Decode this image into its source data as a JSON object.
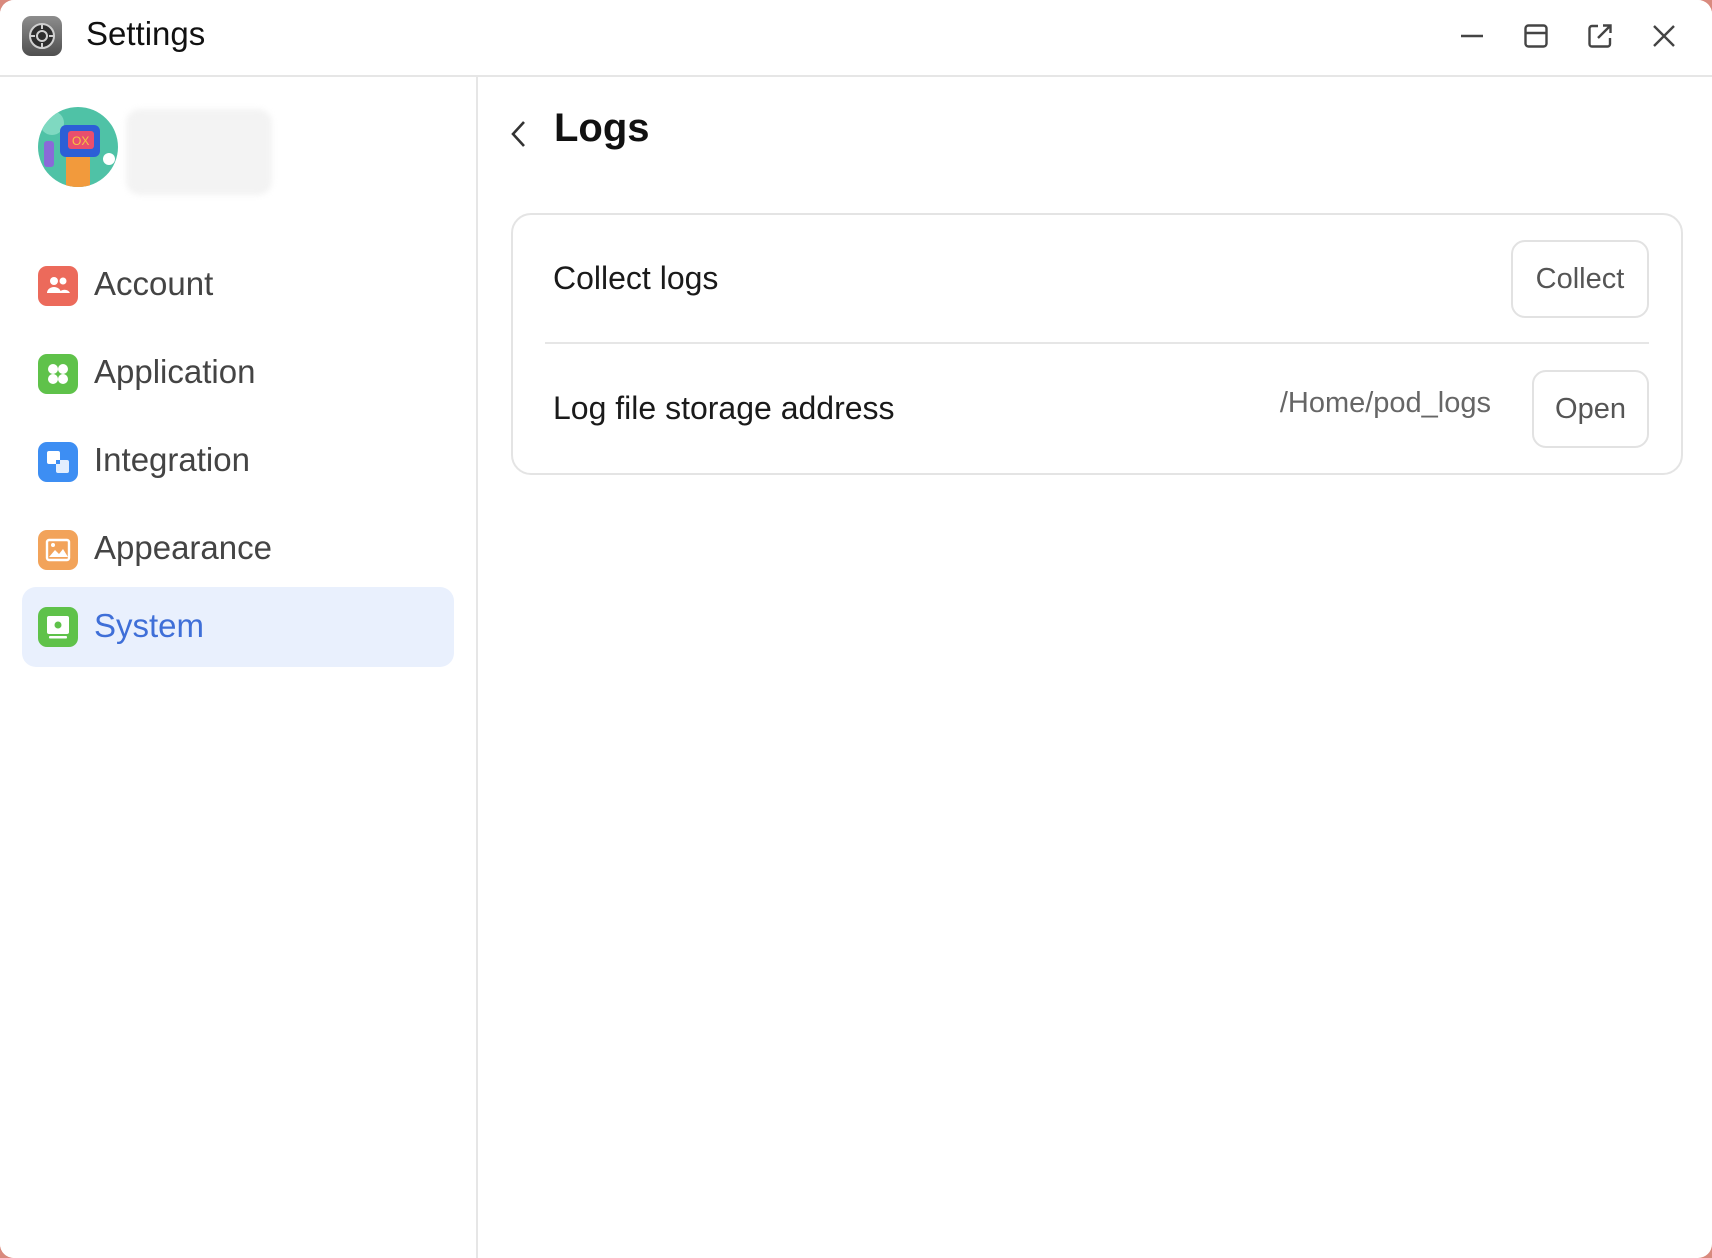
{
  "window": {
    "title": "Settings"
  },
  "titlebar": {
    "buttons": [
      {
        "name": "minimize",
        "icon": "minimize-icon"
      },
      {
        "name": "maximize",
        "icon": "maximize-icon"
      },
      {
        "name": "pop-out",
        "icon": "external-link-icon"
      },
      {
        "name": "close",
        "icon": "close-icon"
      }
    ]
  },
  "sidebar": {
    "items": [
      {
        "label": "Account",
        "icon": "account-icon",
        "color": "#ec6a5b"
      },
      {
        "label": "Application",
        "icon": "application-icon",
        "color": "#5fc24a"
      },
      {
        "label": "Integration",
        "icon": "integration-icon",
        "color": "#3d8ef3"
      },
      {
        "label": "Appearance",
        "icon": "appearance-icon",
        "color": "#f2a35a"
      },
      {
        "label": "System",
        "icon": "system-icon",
        "color": "#5fc24a",
        "active": true
      }
    ],
    "active_color": "#3f6fd8",
    "active_bg": "#e9f0fd"
  },
  "main": {
    "title": "Logs",
    "rows": [
      {
        "label": "Collect logs",
        "button": "Collect"
      },
      {
        "label": "Log file storage address",
        "value": "/Home/pod_logs",
        "button": "Open"
      }
    ]
  }
}
